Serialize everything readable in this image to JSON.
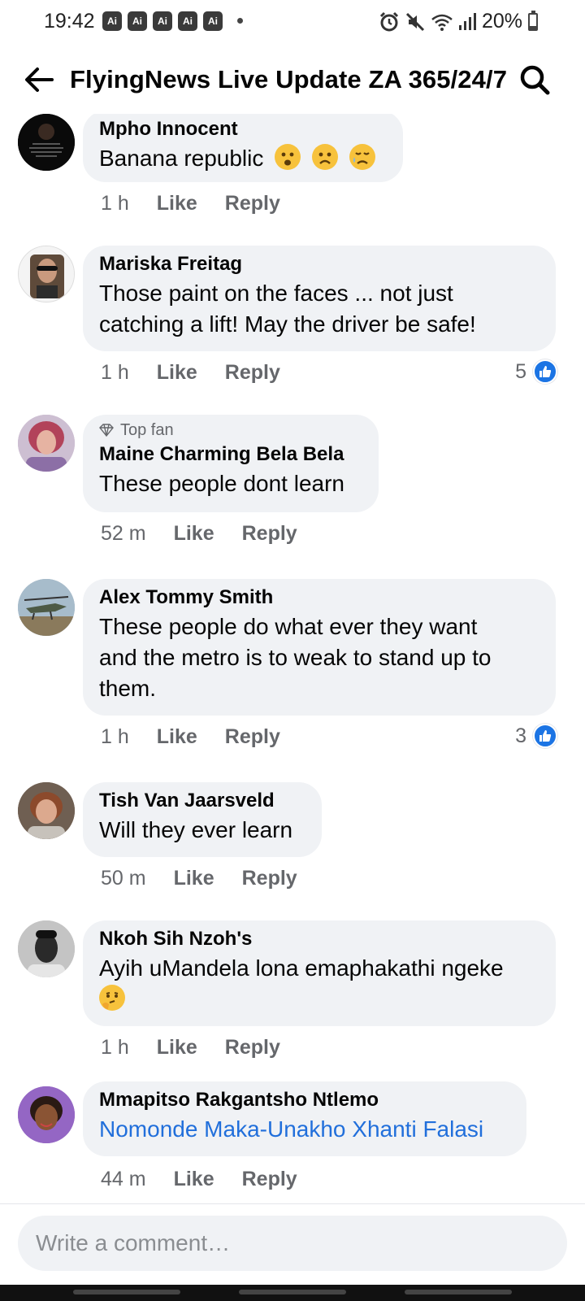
{
  "status_bar": {
    "time": "19:42",
    "ai_badges": [
      "Ai",
      "Ai",
      "Ai",
      "Ai",
      "Ai"
    ],
    "battery": "20%",
    "icons": [
      "alarm-icon",
      "mute-icon",
      "wifi-icon",
      "signal-icon",
      "battery-icon"
    ]
  },
  "header": {
    "title": "FlyingNews Live Update ZA 365/24/7",
    "back_icon": "arrow-left-icon",
    "search_icon": "search-icon"
  },
  "comments": [
    {
      "author": "Mpho Innocent",
      "text": "Banana republic",
      "emojis": [
        "worried-face",
        "frowning-face",
        "sad-relieved-face"
      ],
      "time": "1 h",
      "like": "Like",
      "reply": "Reply"
    },
    {
      "author": "Mariska Freitag",
      "text_lines": [
        "Those paint on the faces ... not just",
        "catching a lift! May the driver be safe!"
      ],
      "time": "1 h",
      "like": "Like",
      "reply": "Reply",
      "reaction_count": "5"
    },
    {
      "badge": "Top fan",
      "author": "Maine Charming Bela Bela",
      "text": "These people dont learn",
      "time": "52 m",
      "like": "Like",
      "reply": "Reply"
    },
    {
      "author": "Alex Tommy Smith",
      "text_lines": [
        "These people do what ever they want",
        "and the metro is to weak to stand up to",
        "them."
      ],
      "time": "1 h",
      "like": "Like",
      "reply": "Reply",
      "reaction_count": "3"
    },
    {
      "author": "Tish Van Jaarsveld",
      "text": "Will they ever learn",
      "time": "50 m",
      "like": "Like",
      "reply": "Reply"
    },
    {
      "author": "Nkoh Sih Nzoh's",
      "text": "Ayih uMandela lona emaphakathi ngeke",
      "emojis": [
        "thinking-face"
      ],
      "time": "1 h",
      "like": "Like",
      "reply": "Reply"
    },
    {
      "author": "Mmapitso Rakgantsho Ntlemo",
      "text": "Nomonde Maka-Unakho Xhanti Falasi",
      "text_is_link": true,
      "time": "44 m",
      "like": "Like",
      "reply": "Reply"
    }
  ],
  "composer": {
    "placeholder": "Write a comment…"
  },
  "colors": {
    "bubble_bg": "#f0f2f5",
    "meta_text": "#65676b",
    "link": "#216fdb",
    "like_blue": "#1b74e4",
    "emoji_yellow": "#f7c23c"
  }
}
